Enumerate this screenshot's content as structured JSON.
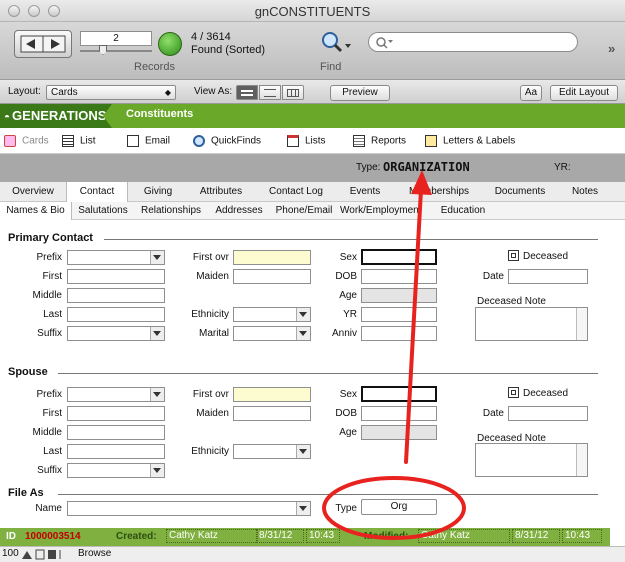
{
  "window": {
    "title": "gnCONSTITUENTS"
  },
  "toolbar": {
    "record_number": "2",
    "record_count": "4 / 3614",
    "found_status": "Found (Sorted)",
    "records_label": "Records",
    "find_label": "Find",
    "search_placeholder": ""
  },
  "layoutbar": {
    "layout_label": "Layout:",
    "layout_value": "Cards",
    "viewas_label": "View As:",
    "preview_label": "Preview",
    "font_btn": "Aa",
    "edit_layout_label": "Edit Layout"
  },
  "header": {
    "logo": "GENERATIONS",
    "section": "Constituents"
  },
  "nav": {
    "cards": "Cards",
    "list": "List",
    "email": "Email",
    "quickfinds": "QuickFinds",
    "lists": "Lists",
    "reports": "Reports",
    "letters": "Letters & Labels"
  },
  "typebar": {
    "type_label": "Type:",
    "type_value": "ORGANIZATION",
    "yr_label": "YR:"
  },
  "tabs": [
    "Overview",
    "Contact",
    "Giving",
    "Attributes",
    "Contact Log",
    "Events",
    "Memberships",
    "Documents",
    "Notes"
  ],
  "subtabs": [
    "Names & Bio",
    "Salutations",
    "Relationships",
    "Addresses",
    "Phone/Email",
    "Work/Employment",
    "Education"
  ],
  "primary": {
    "title": "Primary Contact",
    "labels": {
      "prefix": "Prefix",
      "first": "First",
      "middle": "Middle",
      "last": "Last",
      "suffix": "Suffix",
      "first_ovr": "First ovr",
      "maiden": "Maiden",
      "ethnicity": "Ethnicity",
      "marital": "Marital",
      "sex": "Sex",
      "dob": "DOB",
      "age": "Age",
      "yr": "YR",
      "anniv": "Anniv",
      "deceased": "Deceased",
      "date": "Date",
      "deceased_note": "Deceased Note"
    }
  },
  "spouse": {
    "title": "Spouse",
    "labels": {
      "prefix": "Prefix",
      "first": "First",
      "middle": "Middle",
      "last": "Last",
      "suffix": "Suffix",
      "first_ovr": "First ovr",
      "maiden": "Maiden",
      "ethnicity": "Ethnicity",
      "sex": "Sex",
      "dob": "DOB",
      "age": "Age",
      "deceased": "Deceased",
      "date": "Date",
      "deceased_note": "Deceased Note"
    }
  },
  "fileas": {
    "title": "File As",
    "name_label": "Name",
    "type_label": "Type",
    "type_value": "Org"
  },
  "status": {
    "id_label": "ID",
    "id_value": "1000003514",
    "created_label": "Created:",
    "created_by": "Cathy Katz",
    "created_date": "8/31/12",
    "created_time": "10:43",
    "modified_label": "Modified:",
    "modified_by": "Cathy Katz",
    "modified_date": "8/31/12",
    "modified_time": "10:43"
  },
  "footer": {
    "zoom": "100",
    "mode": "Browse"
  },
  "colors": {
    "brand_green": "#6aa82a",
    "dark_green": "#3b7818",
    "id_red": "#c00000",
    "annotation_red": "#e8231f"
  }
}
